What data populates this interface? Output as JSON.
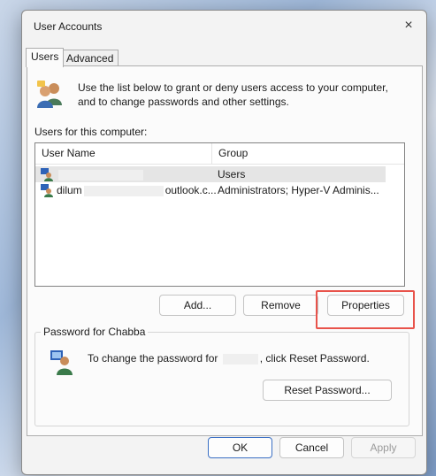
{
  "window": {
    "title": "User Accounts",
    "close_icon": "×"
  },
  "tabs": [
    {
      "label": "Users",
      "active": true
    },
    {
      "label": "Advanced",
      "active": false
    }
  ],
  "info": {
    "text": "Use the list below to grant or deny users access to your computer, and to change passwords and other settings."
  },
  "users": {
    "label": "Users for this computer:",
    "columns": [
      "User Name",
      "Group"
    ],
    "rows": [
      {
        "name_prefix": "",
        "name_suffix": "",
        "group": "Users",
        "selected": true
      },
      {
        "name_prefix": "dilum",
        "name_suffix": "outlook.c...",
        "group": "Administrators; Hyper-V Adminis...",
        "selected": false
      }
    ]
  },
  "buttons": {
    "add": "Add...",
    "remove": "Remove",
    "properties": "Properties",
    "reset_password": "Reset Password...",
    "ok": "OK",
    "cancel": "Cancel",
    "apply": "Apply"
  },
  "password": {
    "title": "Password for Chabba",
    "text_before": "To change the password for",
    "text_after": ", click Reset Password."
  },
  "colors": {
    "highlight": "#e8534b",
    "primary_border": "#3a6fc4"
  }
}
